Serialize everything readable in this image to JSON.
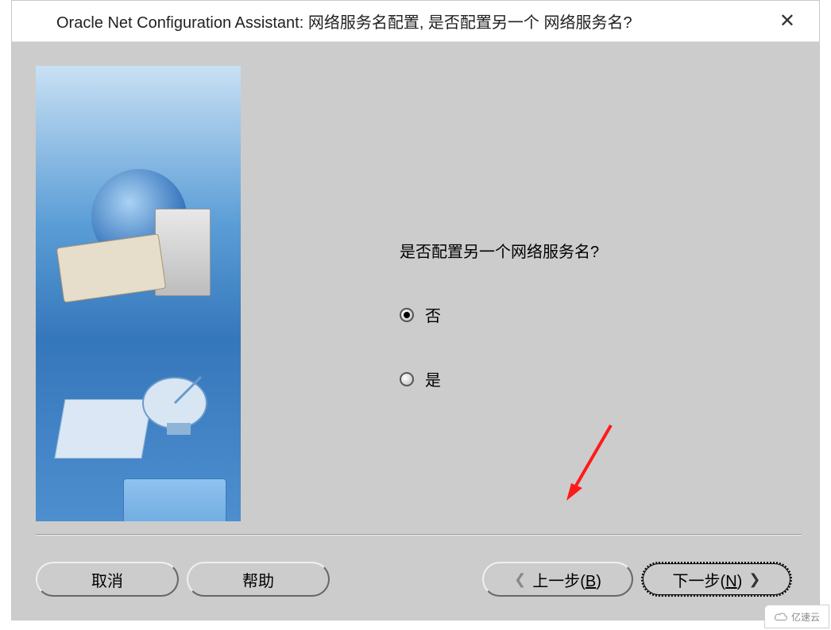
{
  "window": {
    "title": "Oracle Net Configuration Assistant: 网络服务名配置, 是否配置另一个 网络服务名?",
    "close_icon": "✕"
  },
  "prompt": "是否配置另一个网络服务名?",
  "options": {
    "no": "否",
    "yes": "是",
    "selected": "no"
  },
  "buttons": {
    "cancel": "取消",
    "help": "帮助",
    "back_prefix": "上一步(",
    "back_key": "B",
    "back_suffix": ")",
    "next_prefix": "下一步(",
    "next_key": "N",
    "next_suffix": ")"
  },
  "watermark": "亿速云"
}
